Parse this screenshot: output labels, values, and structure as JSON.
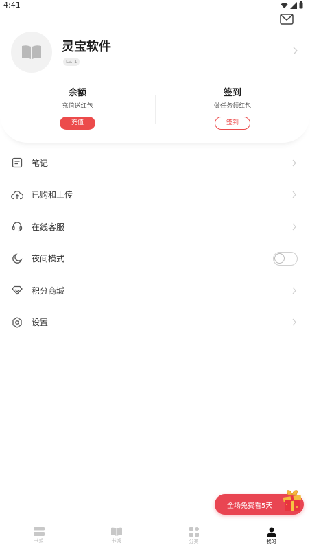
{
  "status_bar": {
    "time": "4:41"
  },
  "profile": {
    "name": "灵宝软件",
    "level": "Lv. 1"
  },
  "wallet": {
    "balance_title": "余额",
    "balance_subtitle": "充值送红包",
    "recharge_label": "充值",
    "signin_title": "签到",
    "signin_subtitle": "做任务领红包",
    "signin_label": "签到"
  },
  "menu": {
    "items": [
      {
        "label": "笔记",
        "icon": "note-icon"
      },
      {
        "label": "已购和上传",
        "icon": "cloud-upload-icon"
      },
      {
        "label": "在线客服",
        "icon": "headset-icon"
      },
      {
        "label": "夜间模式",
        "icon": "moon-icon",
        "toggle": false
      },
      {
        "label": "积分商城",
        "icon": "diamond-icon"
      },
      {
        "label": "设置",
        "icon": "settings-icon"
      }
    ]
  },
  "promo": {
    "label": "全场免费看5天"
  },
  "tabbar": {
    "tabs": [
      {
        "label": "书架",
        "icon": "bookshelf-icon",
        "active": false
      },
      {
        "label": "书城",
        "icon": "book-city-icon",
        "active": false
      },
      {
        "label": "分类",
        "icon": "category-icon",
        "active": false
      },
      {
        "label": "我的",
        "icon": "person-icon",
        "active": true
      }
    ]
  },
  "colors": {
    "accent": "#ec4b4b",
    "promo": "#e94552",
    "text": "#333333",
    "muted": "#bbbbbb"
  }
}
